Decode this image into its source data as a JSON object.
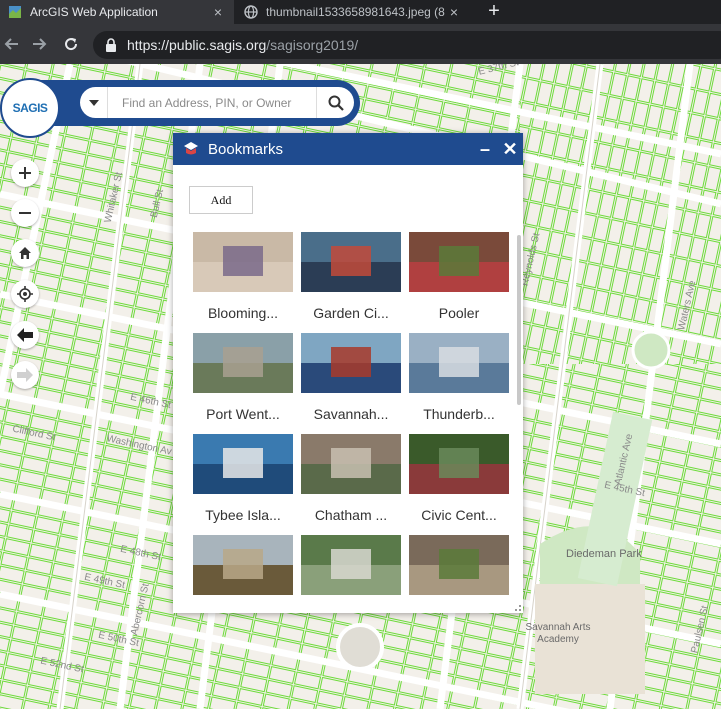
{
  "browser": {
    "tabs": [
      {
        "title": "ArcGIS Web Application",
        "active": true,
        "close": "×"
      },
      {
        "title": "thumbnail1533658981643.jpeg (8",
        "active": false,
        "close": "×"
      }
    ],
    "new_tab": "+",
    "url_host": "https://public.sagis.org",
    "url_path": "/sagisorg2019/"
  },
  "app": {
    "logo_text": "SAGIS",
    "search_placeholder": "Find an Address, PIN, or Owner",
    "brand_color": "#1f4b8f"
  },
  "map_controls": [
    {
      "name": "zoom-in-button",
      "icon": "plus-icon",
      "glyph": "+"
    },
    {
      "name": "zoom-out-button",
      "icon": "minus-icon",
      "glyph": "−"
    },
    {
      "name": "home-button",
      "icon": "home-icon",
      "glyph": ""
    },
    {
      "name": "locate-button",
      "icon": "locate-icon",
      "glyph": ""
    },
    {
      "name": "back-extent-button",
      "icon": "arrow-left-icon",
      "glyph": "🡄"
    },
    {
      "name": "forward-extent-button",
      "icon": "arrow-right-icon",
      "glyph": "🡆"
    }
  ],
  "street_labels": [
    {
      "text": "E 37th St"
    },
    {
      "text": "Whitaker St"
    },
    {
      "text": "Bull St"
    },
    {
      "text": "Abercorn St"
    },
    {
      "text": "Washington Av"
    },
    {
      "text": "Clifford St"
    },
    {
      "text": "E 46th St"
    },
    {
      "text": "E 48th St"
    },
    {
      "text": "E 49th St"
    },
    {
      "text": "E 50th St"
    },
    {
      "text": "E 52nd St"
    },
    {
      "text": "Reynolds St"
    },
    {
      "text": "E 45th St"
    },
    {
      "text": "Atlantic Ave"
    },
    {
      "text": "Diedeman Park"
    },
    {
      "text": "Savannah Arts Academy"
    },
    {
      "text": "Paulsen St"
    },
    {
      "text": "Waters Ave"
    }
  ],
  "bookmarks": {
    "title": "Bookmarks",
    "minimize": "–",
    "close": "✕",
    "add_label": "Add",
    "items": [
      {
        "label": "Blooming...",
        "thumb_colors": [
          "#c9b9a6",
          "#d8c9b8",
          "#7a6a8a"
        ]
      },
      {
        "label": "Garden Ci...",
        "thumb_colors": [
          "#4a6e8a",
          "#2b3d55",
          "#c24a3a"
        ]
      },
      {
        "label": "Pooler",
        "thumb_colors": [
          "#7a4a3a",
          "#b04040",
          "#5a7a3a"
        ]
      },
      {
        "label": "Port Went...",
        "thumb_colors": [
          "#8aa0a8",
          "#6a7a5a",
          "#a8a090"
        ]
      },
      {
        "label": "Savannah...",
        "thumb_colors": [
          "#7fa6c2",
          "#2a4a7a",
          "#a83a2a"
        ]
      },
      {
        "label": "Thunderb...",
        "thumb_colors": [
          "#9ab0c4",
          "#5a7a9a",
          "#d8dde2"
        ]
      },
      {
        "label": "Tybee Isla...",
        "thumb_colors": [
          "#3a7ab0",
          "#1f4b7a",
          "#e8e8e8"
        ]
      },
      {
        "label": "Chatham ...",
        "thumb_colors": [
          "#8a7a6a",
          "#5a6a4a",
          "#c8c0b0"
        ]
      },
      {
        "label": "Civic Cent...",
        "thumb_colors": [
          "#3a5a2a",
          "#8a3a3a",
          "#6a8a5a"
        ]
      },
      {
        "label": "",
        "thumb_colors": [
          "#a8b4bc",
          "#6a5a3a",
          "#b8a888"
        ]
      },
      {
        "label": "",
        "thumb_colors": [
          "#5a7a4a",
          "#8aa07a",
          "#d8d8d0"
        ]
      },
      {
        "label": "",
        "thumb_colors": [
          "#7a6a5a",
          "#a89880",
          "#5a7a3a"
        ]
      }
    ]
  }
}
